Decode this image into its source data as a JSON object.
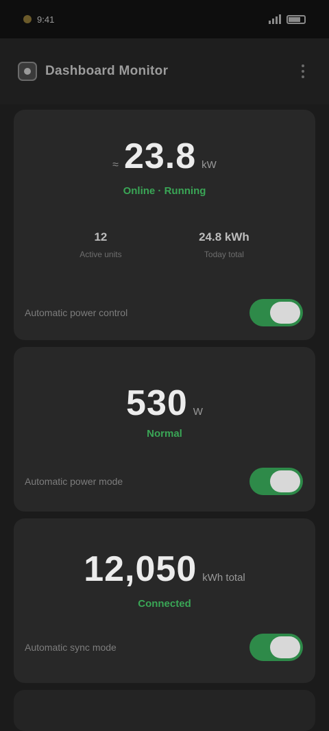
{
  "status_bar": {
    "time": "9:41"
  },
  "header": {
    "title": "Dashboard Monitor"
  },
  "cards": [
    {
      "prefix": "≈",
      "value": "23.8",
      "unit": "kW",
      "status": "Online · Running",
      "stats": [
        {
          "value": "12",
          "label": "Active units"
        },
        {
          "value": "24.8 kWh",
          "label": "Today total"
        }
      ],
      "toggle_label": "Automatic power control",
      "toggle_on": true
    },
    {
      "value": "530",
      "unit": "W",
      "status": "Normal",
      "toggle_label": "Automatic power mode",
      "toggle_on": true
    },
    {
      "value": "12,050",
      "unit": "kWh total",
      "status": "Connected",
      "toggle_label": "Automatic sync mode",
      "toggle_on": true
    }
  ]
}
